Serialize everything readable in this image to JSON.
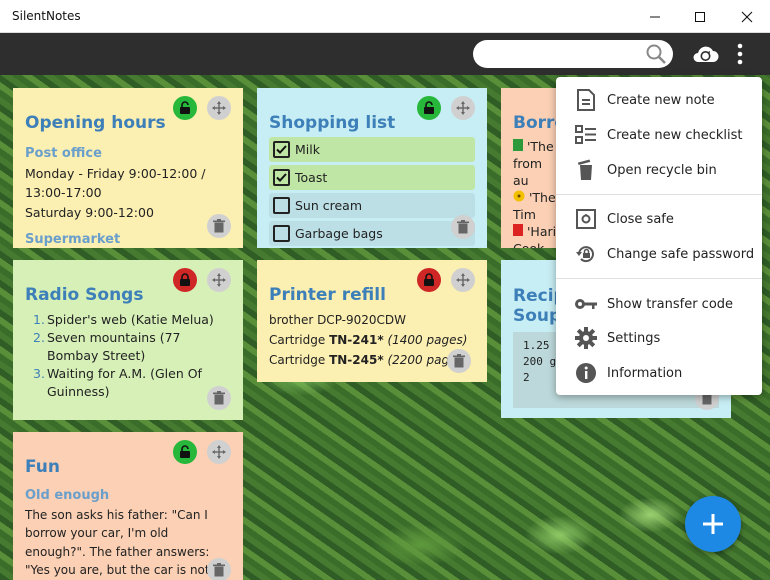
{
  "window": {
    "title": "SilentNotes",
    "minimize": "—",
    "maximize": "☐",
    "close": "✕"
  },
  "search": {
    "placeholder": ""
  },
  "notes": {
    "opening": {
      "title": "Opening hours",
      "sub1": "Post office",
      "line1": "Monday - Friday 9:00-12:00 / 13:00-17:00",
      "line2": "Saturday 9:00-12:00",
      "sub2": "Supermarket"
    },
    "shopping": {
      "title": "Shopping list",
      "items": [
        "Milk",
        "Toast",
        "Sun cream",
        "Garbage bags"
      ]
    },
    "borrowed": {
      "title": "Borro",
      "l1": "'The",
      "l2": "from au",
      "l3": "'The",
      "l4": "Tim",
      "l5": "'Hari",
      "l6": "Cook"
    },
    "radio": {
      "title": "Radio Songs",
      "songs": [
        "Spider's web (Katie Melua)",
        "Seven mountains (77 Bombay Street)",
        "Waiting for A.M. (Glen Of Guinness)"
      ],
      "nums": [
        "1.",
        "2.",
        "3."
      ]
    },
    "printer": {
      "title": "Printer refill",
      "model": "brother DCP-9020CDW",
      "c1_prefix": "Cartridge ",
      "c1_bold": "TN-241*",
      "c1_pages": "(1400 pages)",
      "c2_prefix": "Cartridge ",
      "c2_bold": "TN-245*",
      "c2_pages": "(2200 pages)"
    },
    "recipe": {
      "title1": "Recip",
      "title2": "Soup",
      "code1": "1.25",
      "code2": "200 g",
      "code3": "2"
    },
    "fun": {
      "title": "Fun",
      "sub": "Old enough",
      "text": "The son asks his father: \"Can I borrow your car, I'm old enough?\". The father answers: \"Yes you are, but the car is not\"."
    }
  },
  "menu": {
    "items": [
      {
        "label": "Create new note",
        "icon": "note-icon"
      },
      {
        "label": "Create new checklist",
        "icon": "checklist-icon"
      },
      {
        "label": "Open recycle bin",
        "icon": "recycle-bin-icon"
      },
      {
        "label": "Close safe",
        "icon": "safe-icon"
      },
      {
        "label": "Change safe password",
        "icon": "lock-reset-icon"
      },
      {
        "label": "Show transfer code",
        "icon": "key-icon"
      },
      {
        "label": "Settings",
        "icon": "gear-icon"
      },
      {
        "label": "Information",
        "icon": "info-icon"
      }
    ]
  },
  "colors": {
    "toolbar": "#2e2e2e",
    "accent": "#1e88e5",
    "title_blue": "#3d7fb8",
    "note_yellow": "#fbefb2",
    "note_cyan": "#c7eef4",
    "note_green": "#d7f0b8",
    "note_peach": "#fbd0b4"
  }
}
